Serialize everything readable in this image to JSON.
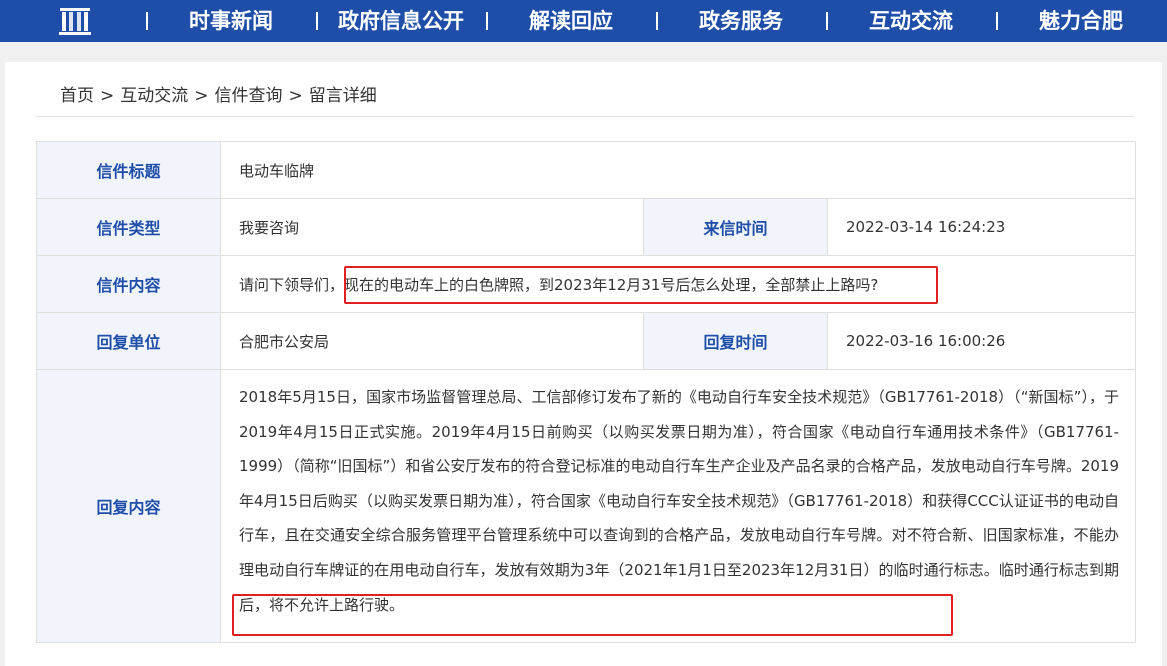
{
  "nav": {
    "logo_icon": "building-pillars-icon",
    "items": [
      "时事新闻",
      "政府信息公开",
      "解读回应",
      "政务服务",
      "互动交流",
      "魅力合肥"
    ]
  },
  "breadcrumb": {
    "items": [
      "首页",
      "互动交流",
      "信件查询",
      "留言详细"
    ],
    "separator": ">"
  },
  "letter": {
    "title_label": "信件标题",
    "title": "电动车临牌",
    "type_label": "信件类型",
    "type": "我要咨询",
    "sent_time_label": "来信时间",
    "sent_time": "2022-03-14 16:24:23",
    "content_label": "信件内容",
    "content_prefix": "请问下领导们，",
    "content_highlight": "现在的电动车上的白色牌照，到2023年12月31号后怎么处理，全部禁止上路吗?",
    "reply_unit_label": "回复单位",
    "reply_unit": "合肥市公安局",
    "reply_time_label": "回复时间",
    "reply_time": "2022-03-16 16:00:26",
    "reply_label": "回复内容",
    "reply_text": "2018年5月15日，国家市场监督管理总局、工信部修订发布了新的《电动自行车安全技术规范》（GB17761-2018）（“新国标”），于2019年4月15日正式实施。2019年4月15日前购买（以购买发票日期为准），符合国家《电动自行车通用技术条件》（GB17761-1999）（简称“旧国标”）和省公安厅发布的符合登记标准的电动自行车生产企业及产品名录的合格产品，发放电动自行车号牌。2019年4月15日后购买（以购买发票日期为准），符合国家《电动自行车安全技术规范》（GB17761-2018）和获得CCC认证证书的电动自行车，且在交通安全综合服务管理平台管理系统中可以查询到的合格产品，发放电动自行车号牌。对不符合新、旧国家标准，不能办理电动自行车牌证的在用电动自行车，发放有效期为3年（2021年1月1日至2023年12月31日）的临时通行标志。临时通行标志到期后，将不允许上路行驶。"
  },
  "colors": {
    "nav_bg": "#1f4ea8",
    "label_text": "#1f4ea8",
    "label_bg": "#f1f5fb",
    "highlight_border": "#e02020"
  }
}
